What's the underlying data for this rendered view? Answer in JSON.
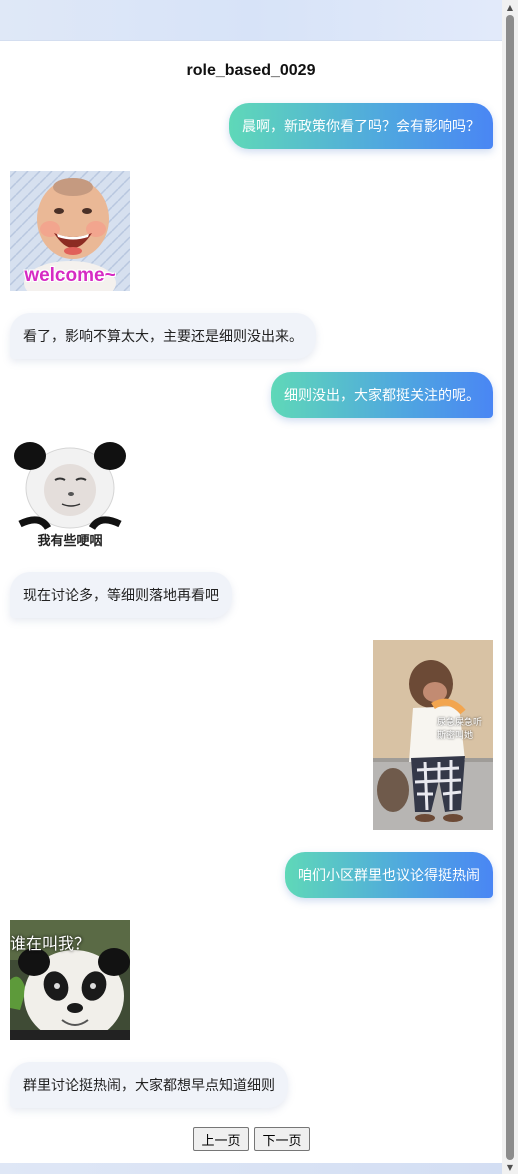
{
  "page": {
    "title": "role_based_0029"
  },
  "messages": [
    {
      "side": "right",
      "type": "text",
      "text": "晨啊，新政策你看了吗？会有影响吗？"
    },
    {
      "side": "left",
      "type": "sticker",
      "caption": "welcome~"
    },
    {
      "side": "left",
      "type": "text",
      "text": "看了，影响不算太大，主要还是细则没出来。"
    },
    {
      "side": "right",
      "type": "text",
      "text": "细则没出，大家都挺关注的呢。"
    },
    {
      "side": "left",
      "type": "sticker",
      "caption": "我有些哽咽"
    },
    {
      "side": "left",
      "type": "text",
      "text": "现在讨论多，等细则落地再看吧"
    },
    {
      "side": "right",
      "type": "sticker",
      "caption_line1": "尿急屎急听",
      "caption_line2": "斯密叫她"
    },
    {
      "side": "right",
      "type": "text",
      "text": "咱们小区群里也议论得挺热闹"
    },
    {
      "side": "left",
      "type": "sticker",
      "caption": "谁在叫我？"
    },
    {
      "side": "left",
      "type": "text",
      "text": "群里讨论挺热闹，大家都想早点知道细则"
    }
  ],
  "pager": {
    "prev_label": "上一页",
    "next_label": "下一页"
  },
  "colors": {
    "bubble_right_start": "#5fd8b8",
    "bubble_right_end": "#4a86f4",
    "bubble_left": "#f0f3f9",
    "header_band": "#dfe8f7"
  },
  "icons": {
    "scroll_up": "scroll-up-arrow-icon",
    "scroll_down": "scroll-down-arrow-icon"
  }
}
